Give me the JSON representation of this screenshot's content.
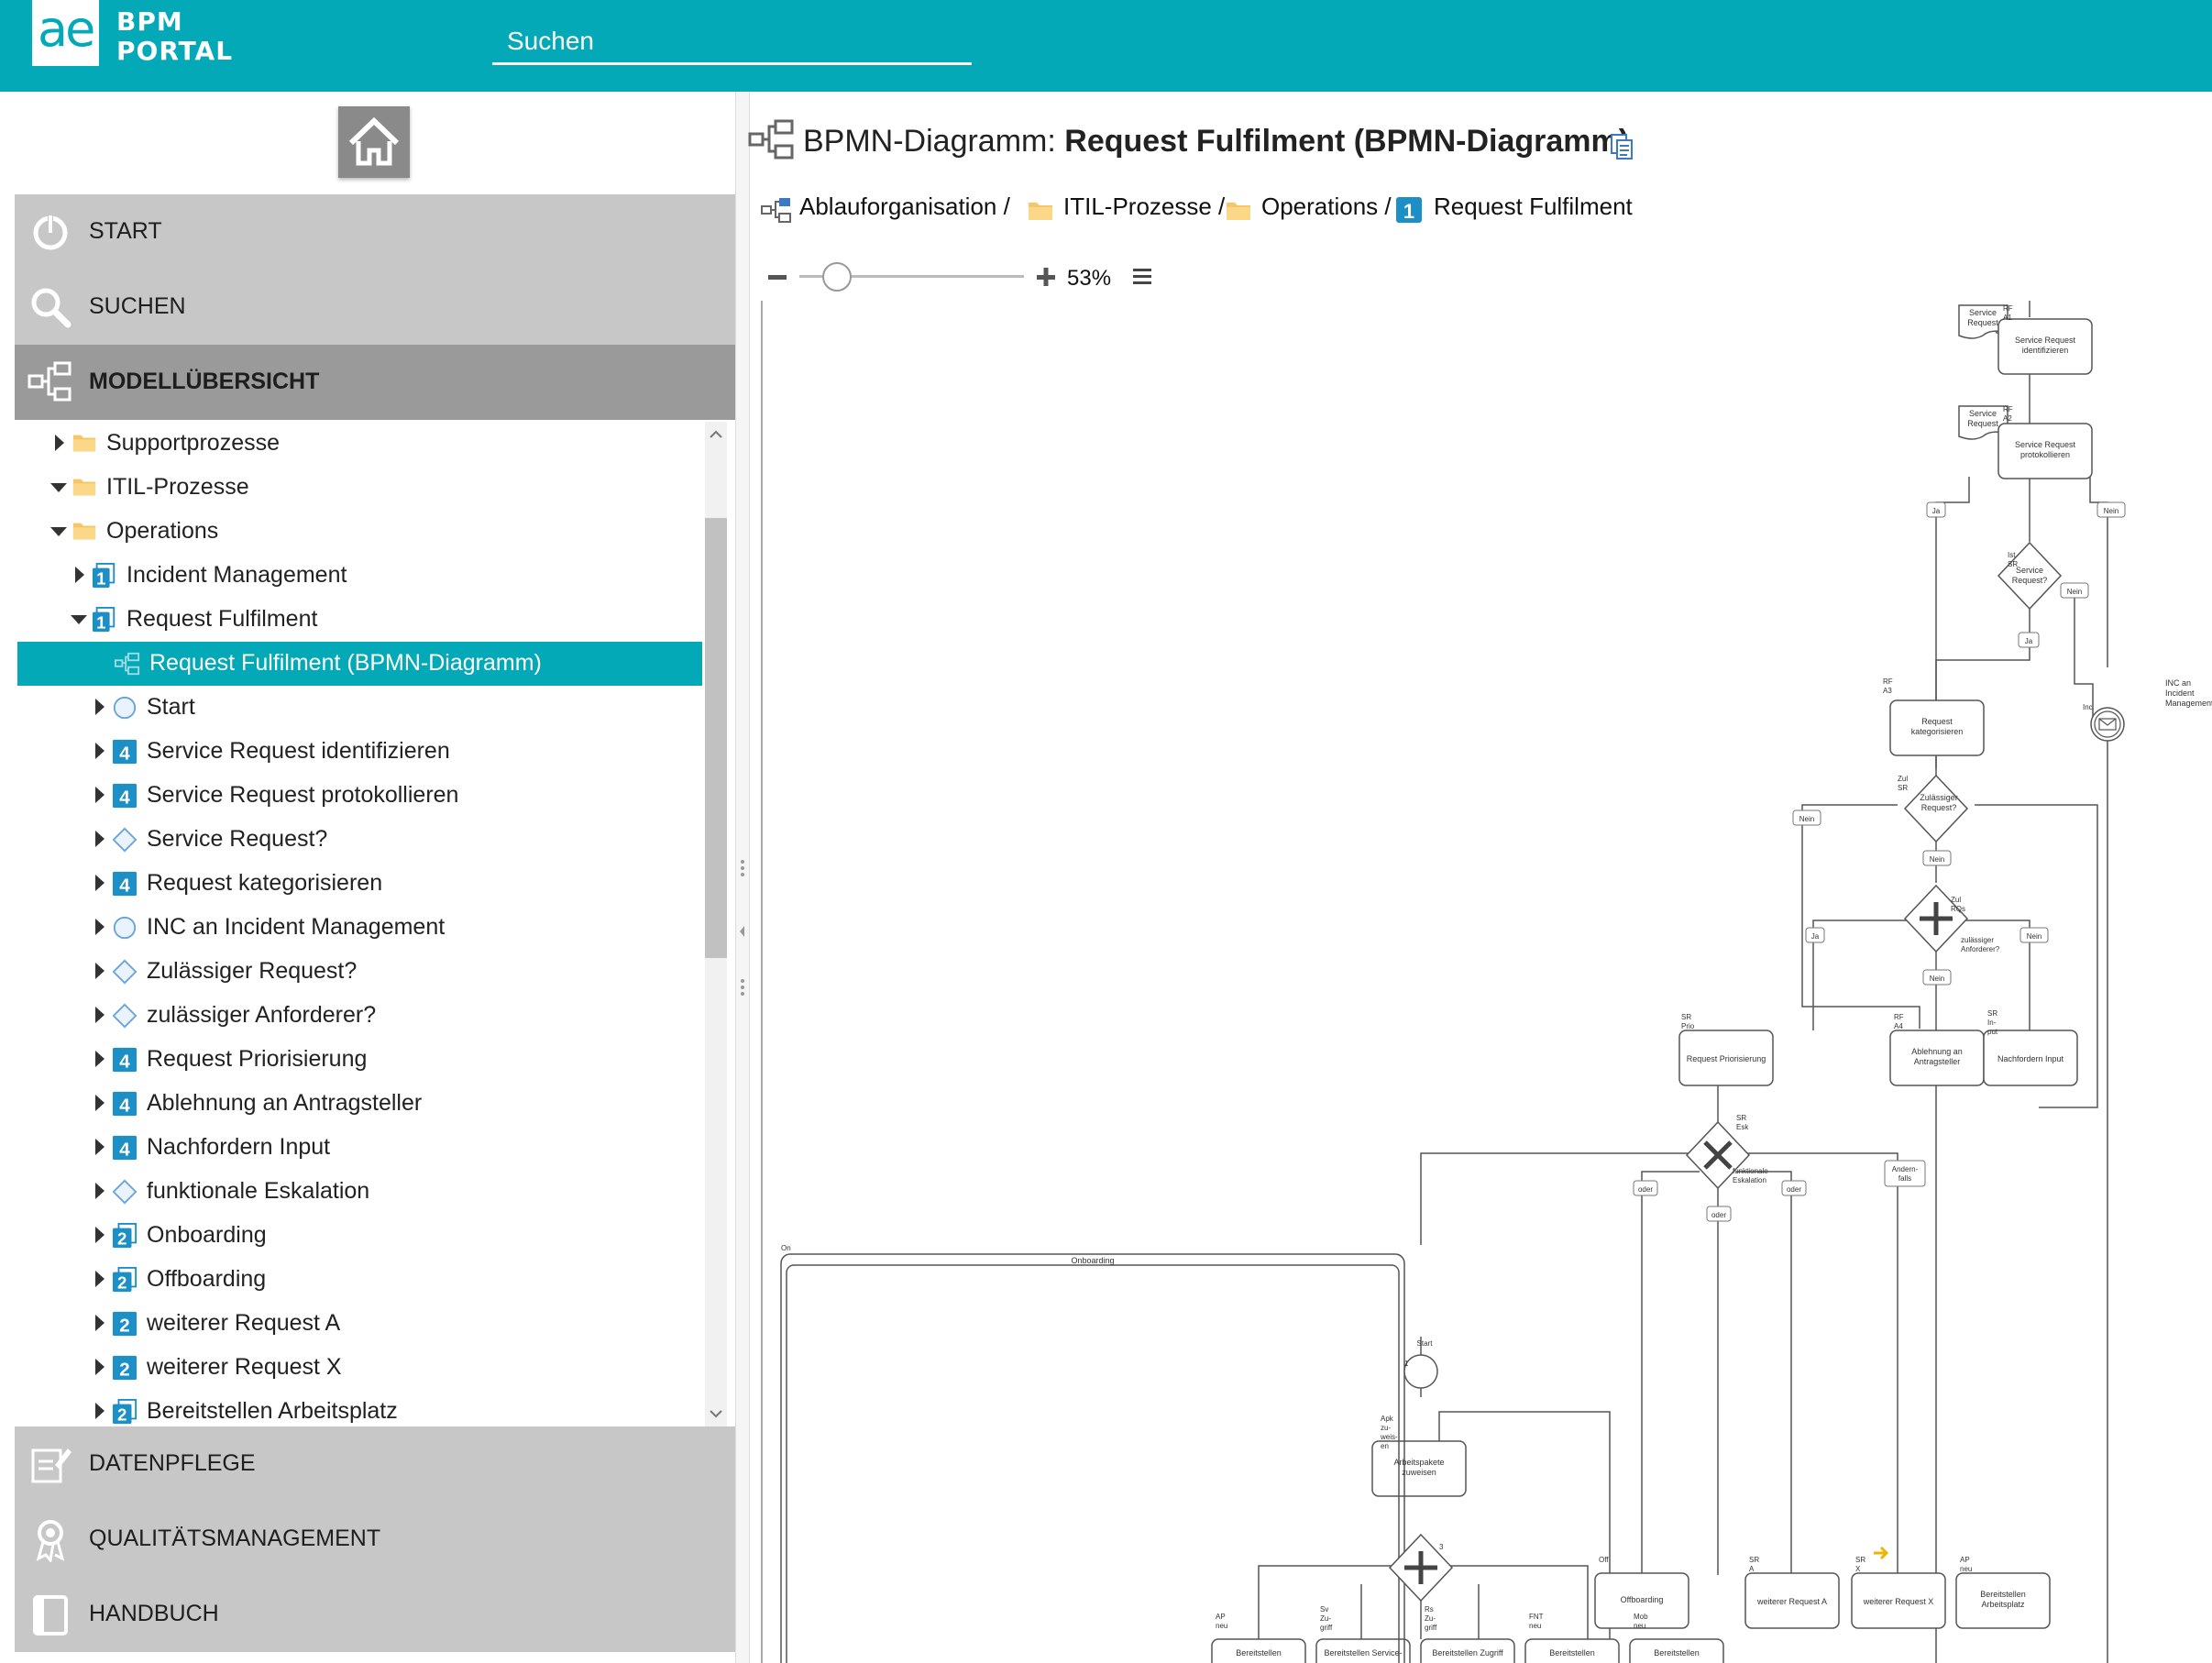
{
  "header": {
    "logo_mark": "ae",
    "logo_line1": "BPM",
    "logo_line2": "PORTAL",
    "search_placeholder": "Suchen"
  },
  "sidebar": {
    "nav_top": [
      {
        "label": "START",
        "icon": "power-icon"
      },
      {
        "label": "SUCHEN",
        "icon": "magnifier-icon"
      },
      {
        "label": "MODELLÜBERSICHT",
        "icon": "model-tree-icon",
        "active": true
      }
    ],
    "nav_bottom": [
      {
        "label": "DATENPFLEGE",
        "icon": "edit-form-icon"
      },
      {
        "label": "QUALITÄTSMANAGEMENT",
        "icon": "award-icon"
      },
      {
        "label": "HANDBUCH",
        "icon": "book-icon"
      }
    ],
    "tree": [
      {
        "label": "Supportprozesse",
        "icon": "folder-icon",
        "level": 0,
        "caret": "right"
      },
      {
        "label": "ITIL-Prozesse",
        "icon": "folder-icon",
        "level": 0,
        "caret": "down"
      },
      {
        "label": "Operations",
        "icon": "folder-icon",
        "level": 1,
        "caret": "down"
      },
      {
        "label": "Incident Management",
        "icon": "model-1-icon",
        "level": 2,
        "caret": "right"
      },
      {
        "label": "Request Fulfilment",
        "icon": "model-1-icon",
        "level": 2,
        "caret": "down"
      },
      {
        "label": "Request Fulfilment (BPMN-Diagramm)",
        "icon": "bpmn-diagram-icon",
        "level": 3,
        "caret": "none",
        "selected": true
      },
      {
        "label": "Start",
        "icon": "start-event-icon",
        "level": 3,
        "caret": "right"
      },
      {
        "label": "Service Request identifizieren",
        "icon": "task-4-icon",
        "level": 3,
        "caret": "right"
      },
      {
        "label": "Service Request protokollieren",
        "icon": "task-4-icon",
        "level": 3,
        "caret": "right"
      },
      {
        "label": "Service Request?",
        "icon": "gateway-icon",
        "level": 3,
        "caret": "right"
      },
      {
        "label": "Request kategorisieren",
        "icon": "task-4-icon",
        "level": 3,
        "caret": "right"
      },
      {
        "label": "INC an Incident Management",
        "icon": "start-event-icon",
        "level": 3,
        "caret": "right"
      },
      {
        "label": "Zulässiger Request?",
        "icon": "gateway-icon",
        "level": 3,
        "caret": "right"
      },
      {
        "label": "zulässiger Anforderer?",
        "icon": "gateway-icon",
        "level": 3,
        "caret": "right"
      },
      {
        "label": "Request Priorisierung",
        "icon": "task-4-icon",
        "level": 3,
        "caret": "right"
      },
      {
        "label": "Ablehnung an Antragsteller",
        "icon": "task-4-icon",
        "level": 3,
        "caret": "right"
      },
      {
        "label": "Nachfordern Input",
        "icon": "task-4-icon",
        "level": 3,
        "caret": "right"
      },
      {
        "label": "funktionale Eskalation",
        "icon": "gateway-icon",
        "level": 3,
        "caret": "right"
      },
      {
        "label": "Onboarding",
        "icon": "subprocess-2-icon",
        "level": 3,
        "caret": "right"
      },
      {
        "label": "Offboarding",
        "icon": "subprocess-2-icon",
        "level": 3,
        "caret": "right"
      },
      {
        "label": "weiterer Request A",
        "icon": "model-2-icon",
        "level": 3,
        "caret": "right"
      },
      {
        "label": "weiterer Request X",
        "icon": "model-2-icon",
        "level": 3,
        "caret": "right"
      },
      {
        "label": "Bereitstellen Arbeitsplatz",
        "icon": "subprocess-2-icon",
        "level": 3,
        "caret": "right"
      }
    ]
  },
  "main": {
    "title_prefix": "BPMN-Diagramm:",
    "title_name": "Request Fulfilment (BPMN-Diagramm)",
    "breadcrumb": [
      "Ablauforganisation /",
      "ITIL-Prozesse /",
      "Operations /",
      "Request Fulfilment"
    ],
    "zoom_percent": "53%",
    "zoom_level": 0.16
  },
  "diagram": {
    "doc1": "Service\nRequest",
    "doc2": "Service\nRequest",
    "t_identify": "Service Request\nidentifizieren",
    "t_protocol": "Service Request\nprotokollieren",
    "gw_service": "Service\nRequest?",
    "ja": "Ja",
    "nein": "Nein",
    "oder": "oder",
    "andernfalls": "Andern-\nfalls",
    "t_categorize": "Request\nkategorisieren",
    "inc_event": "INC an\nIncident\nManagement",
    "gw_valid": "Zulässiger\nRequest?",
    "gw_requester": "zulässiger\nAnforderer?",
    "t_priority": "Request Priorisierung",
    "t_reject": "Ablehnung an\nAntragsteller",
    "t_input": "Nachfordern Input",
    "gw_escalation": "funktionale\nEskalation",
    "onboarding": "Onboarding",
    "offboarding": "Offboarding",
    "req_a": "weiterer Request A",
    "req_x": "weiterer Request X",
    "workplace": "Bereitstellen\nArbeitsplatz",
    "start": "Start",
    "assign": "Arbeitspakete\nzuweisen",
    "sub1": "Bereitstellen",
    "sub2": "Bereitstellen Service-",
    "sub3": "Bereitstellen Zugriff",
    "sub4": "Bereitstellen",
    "sub5": "Bereitstellen",
    "lbl_rf_a1": "RF\nA1",
    "lbl_rf_a2": "RF\nA2",
    "lbl_rf_a3": "RF\nA3",
    "lbl_rf_a4": "RF\nA4",
    "lbl_ist_sr": "Ist\nSR",
    "lbl_zul_sr": "Zul\nSR",
    "lbl_zul_rqs": "Zul\nRQs",
    "lbl_sr_prio": "SR\nPrio",
    "lbl_sr_input": "SR\nIn-\nput",
    "lbl_sr_esk": "SR\nEsk",
    "lbl_on": "On",
    "lbl_off": "Off",
    "lbl_sr_a": "SR\nA",
    "lbl_sr_x": "SR\nX",
    "lbl_ap_neu": "AP\nneu",
    "lbl_inc": "Inc",
    "lbl_one": "1",
    "lbl_three": "3",
    "lbl_apk": "Apk\nzu-\nweis-\nen",
    "lbl_sub1": "AP\nneu",
    "lbl_sub2": "Sv\nZu-\ngriff",
    "lbl_sub3": "Rs\nZu-\ngriff",
    "lbl_sub4": "FNT\nneu",
    "lbl_sub5": "Mob\nneu"
  },
  "colors": {
    "header": "#04a9b8",
    "selected": "#04a9b8",
    "nav": "#c7c7c7",
    "nav_active": "#9a9a9a"
  }
}
